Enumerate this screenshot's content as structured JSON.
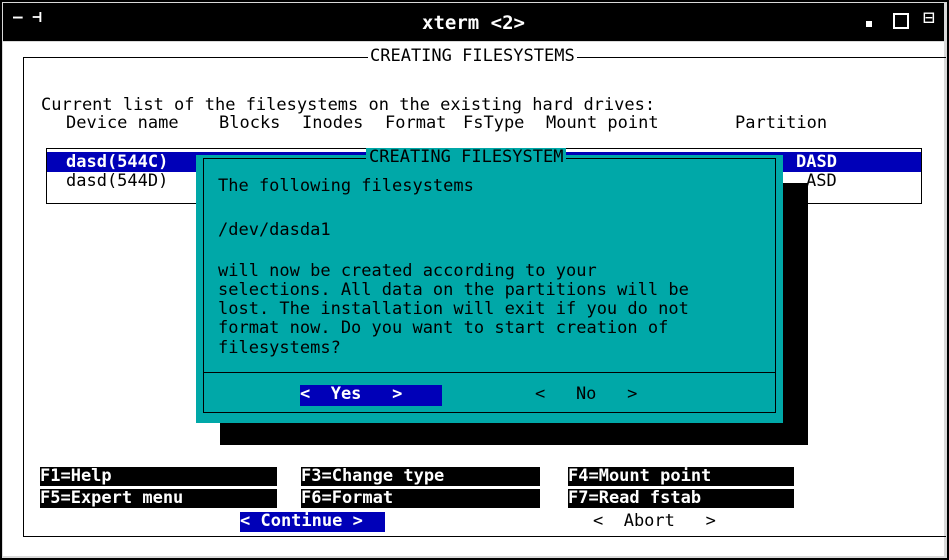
{
  "window": {
    "title": "xterm <2>",
    "menu_glyph": "— ⊣",
    "close_glyph": "⊟"
  },
  "main": {
    "title": "CREATING FILESYSTEMS",
    "description": "Current list of the filesystems on the existing hard drives:",
    "columns": [
      "Device name",
      "Blocks",
      "Inodes",
      "Format",
      "FsType",
      "Mount point",
      "Partition"
    ],
    "rows": [
      {
        "device": "dasd(544C)",
        "partition": "DASD",
        "selected": true
      },
      {
        "device": "dasd(544D)",
        "partition": "ASD",
        "selected": false
      }
    ]
  },
  "dialog": {
    "title": "CREATING FILESYSTEM",
    "line1": "The following filesystems",
    "device_path": "/dev/dasda1",
    "message_lines": [
      "will now be created according to your",
      "selections. All data on the partitions will be",
      "lost. The installation will exit if you do not",
      "format now. Do you want to start creation of",
      "filesystems?"
    ],
    "yes_label": "<  Yes   >",
    "no_label": "<   No   >"
  },
  "fkeys": {
    "f1": "F1=Help",
    "f3": "F3=Change type",
    "f4": "F4=Mount point",
    "f5": "F5=Expert menu",
    "f6": "F6=Format",
    "f7": "F7=Read fstab"
  },
  "bottom_buttons": {
    "continue": "< Continue >",
    "abort": "<  Abort   >"
  },
  "colors": {
    "dialog_bg": "#00a8a8",
    "selection_bg": "#0000b8",
    "window_bg": "#d9d9d9"
  }
}
